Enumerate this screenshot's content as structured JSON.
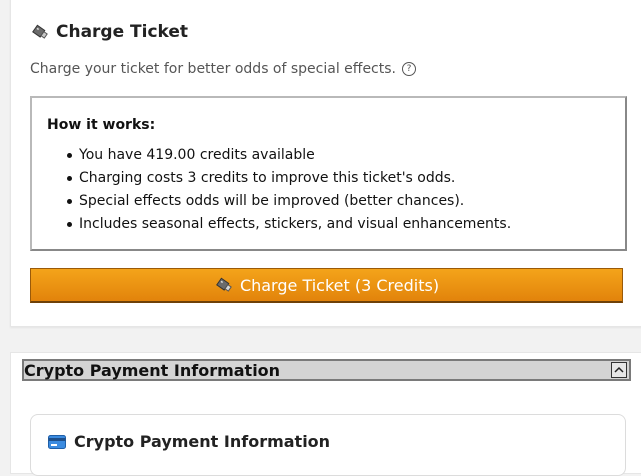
{
  "charge": {
    "title": "Charge Ticket",
    "icon": "usb-ticket-icon",
    "description": "Charge your ticket for better odds of special effects.",
    "how_title": "How it works:",
    "bullets": [
      "You have 419.00 credits available",
      "Charging costs 3 credits to improve this ticket's odds.",
      "Special effects odds will be improved (better chances).",
      "Includes seasonal effects, stickers, and visual enhancements."
    ],
    "button_label": "Charge Ticket (3 Credits)",
    "button_color": "#f0960f"
  },
  "crypto": {
    "section_label": "Crypto Payment Information",
    "inner_title": "Crypto Payment Information",
    "icon": "credit-card-icon"
  }
}
